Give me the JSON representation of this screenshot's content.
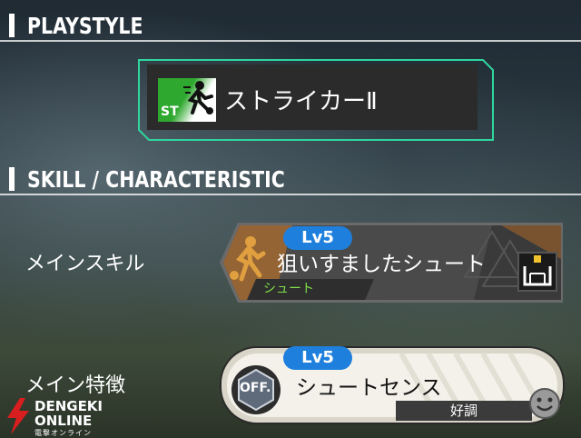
{
  "sections": {
    "playstyle_title": "PLAYSTYLE",
    "skill_title": "SKILL / CHARACTERISTIC"
  },
  "playstyle": {
    "badge": "ST",
    "name": "ストライカーⅡ",
    "icon": "kicking-player-icon"
  },
  "main_skill": {
    "row_label": "メインスキル",
    "level": "Lv5",
    "name": "狙いすましたシュート",
    "type": "シュート",
    "icon": "shooting-player-icon",
    "target_icon": "goal-target-icon"
  },
  "main_trait": {
    "row_label": "メイン特徴",
    "level": "Lv5",
    "badge": "OFF.",
    "name": "シュートセンス",
    "condition": "好調",
    "condition_icon": "smiley-face-icon"
  },
  "watermark": {
    "brand_line1": "DENGEKI",
    "brand_line2": "ONLINE",
    "tagline": "電撃オンライン"
  },
  "colors": {
    "accent_green": "#2fd6a0",
    "level_blue": "#1e7fdc",
    "skill_type_green": "#7fe04a",
    "watermark_red": "#d81e1e"
  }
}
